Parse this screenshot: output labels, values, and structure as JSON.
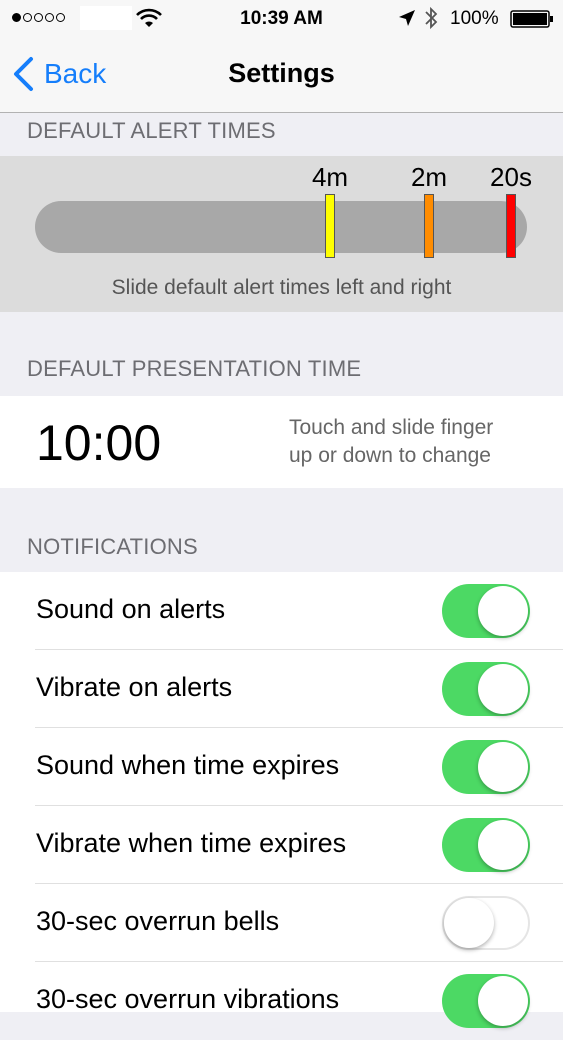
{
  "status_bar": {
    "time": "10:39 AM",
    "battery_percent": "100%",
    "icons": [
      "signal-dots",
      "wifi-icon",
      "location-icon",
      "bluetooth-icon",
      "battery-icon"
    ]
  },
  "nav": {
    "back_label": "Back",
    "title": "Settings"
  },
  "alert_times": {
    "header": "DEFAULT ALERT TIMES",
    "markers": [
      {
        "label": "4m",
        "color": "#ffff00"
      },
      {
        "label": "2m",
        "color": "#ff8c00"
      },
      {
        "label": "20s",
        "color": "#ff0000"
      }
    ],
    "hint": "Slide default alert times left and right"
  },
  "presentation": {
    "header": "DEFAULT PRESENTATION TIME",
    "time": "10:00",
    "hint_line1": "Touch and slide finger",
    "hint_line2": "up or down to change"
  },
  "notifications": {
    "header": "NOTIFICATIONS",
    "items": [
      {
        "label": "Sound on alerts",
        "enabled": true
      },
      {
        "label": "Vibrate on alerts",
        "enabled": true
      },
      {
        "label": "Sound when time expires",
        "enabled": true
      },
      {
        "label": "Vibrate when time expires",
        "enabled": true
      },
      {
        "label": "30-sec overrun bells",
        "enabled": false
      },
      {
        "label": "30-sec overrun vibrations",
        "enabled": true
      }
    ]
  },
  "colors": {
    "accent": "#157efb",
    "toggle_on": "#4cd964"
  }
}
